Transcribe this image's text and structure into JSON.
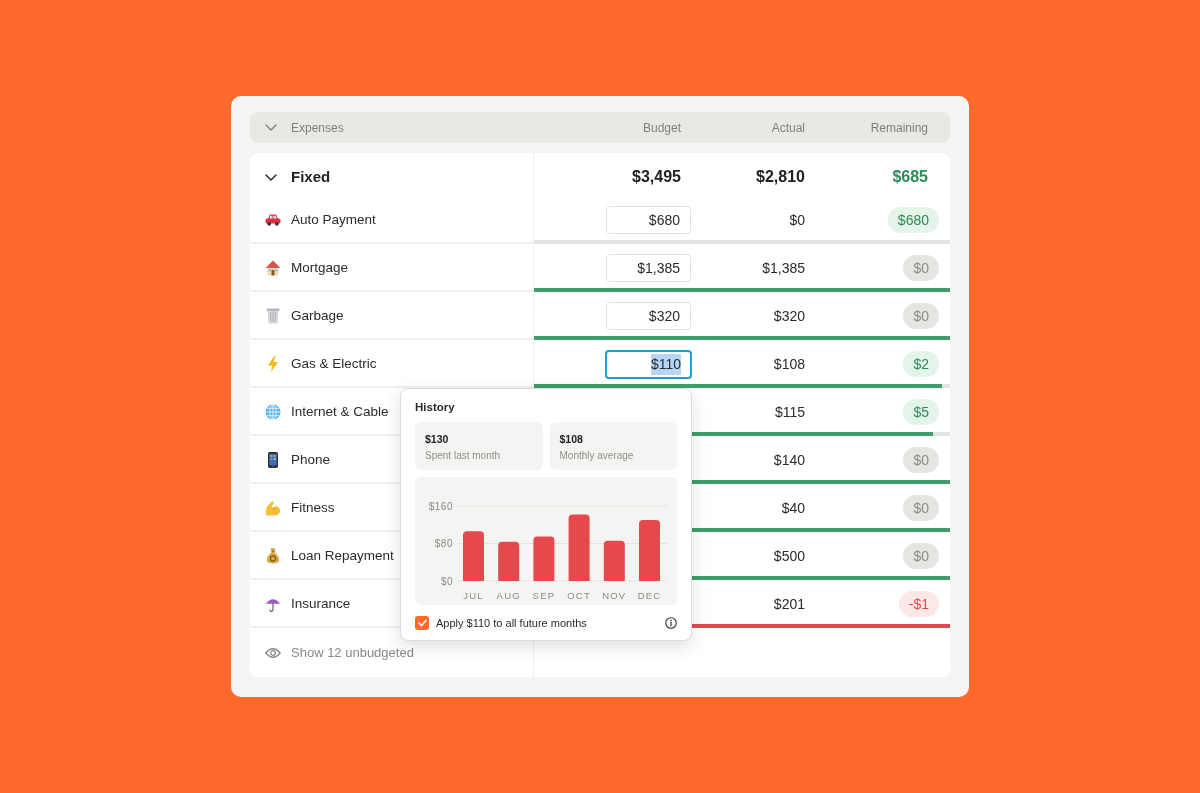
{
  "header": {
    "expanded": true,
    "title": "Expenses",
    "columns": [
      "Budget",
      "Actual",
      "Remaining"
    ]
  },
  "group": {
    "name": "Fixed",
    "expanded": true,
    "budget": "$3,495",
    "actual": "$2,810",
    "remaining": "$685"
  },
  "rows": [
    {
      "name": "Auto Payment",
      "budget": "$680",
      "focused": false,
      "actual": "$0",
      "remaining": "$680",
      "kind": "under",
      "level": 0
    },
    {
      "name": "Mortgage",
      "budget": "$1,385",
      "focused": false,
      "actual": "$1,385",
      "remaining": "$0",
      "kind": "met",
      "level": 1
    },
    {
      "name": "Garbage",
      "budget": "$320",
      "focused": false,
      "actual": "$320",
      "remaining": "$0",
      "kind": "met",
      "level": 1
    },
    {
      "name": "Gas & Electric",
      "budget": "$110",
      "focused": true,
      "actual": "$108",
      "remaining": "$2",
      "kind": "under",
      "level": 0.98
    },
    {
      "name": "Internet & Cable",
      "actual": "$115",
      "remaining": "$5",
      "kind": "under",
      "level": 0.96
    },
    {
      "name": "Phone",
      "actual": "$140",
      "remaining": "$0",
      "kind": "met",
      "level": 1
    },
    {
      "name": "Fitness",
      "actual": "$40",
      "remaining": "$0",
      "kind": "met",
      "level": 1
    },
    {
      "name": "Loan Repayment",
      "actual": "$500",
      "remaining": "$0",
      "kind": "met",
      "level": 1
    },
    {
      "name": "Insurance",
      "actual": "$201",
      "remaining": "-$1",
      "kind": "over",
      "level": 1
    }
  ],
  "footer": {
    "label": "Show 12 unbudgeted"
  },
  "history_popup": {
    "title": "History",
    "stats": [
      {
        "value": "$130",
        "label": "Spent last month"
      },
      {
        "value": "$108",
        "label": "Monthly average"
      }
    ],
    "chart_data": [
      {
        "type": "bar",
        "categories": [
          "JUL",
          "AUG",
          "SEP",
          "OCT",
          "NOV",
          "DEC"
        ],
        "values": [
          106,
          84,
          95,
          142,
          86,
          130
        ],
        "color": "#e5484d",
        "ylim": [
          0,
          160
        ],
        "yticks": [
          {
            "value": 0,
            "label": "$0"
          },
          {
            "value": 80,
            "label": "$80"
          },
          {
            "value": 160,
            "label": "$160"
          }
        ],
        "grid": true
      }
    ],
    "apply": {
      "label": "Apply $110 to all future months",
      "checked": true
    }
  }
}
